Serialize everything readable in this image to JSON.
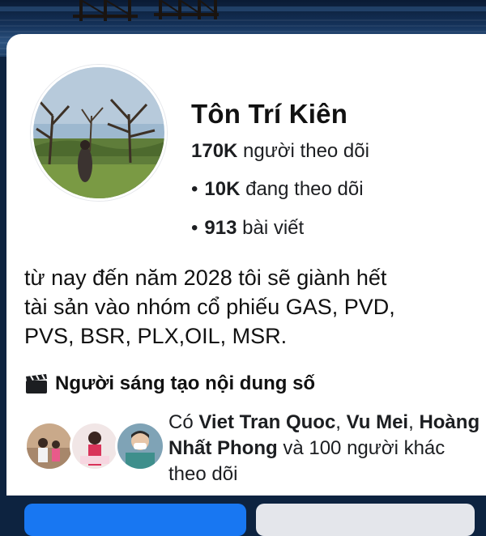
{
  "profile": {
    "name": "Tôn Trí Kiên",
    "followers_value": "170K",
    "followers_label": "người theo dõi",
    "following_value": "10K",
    "following_label": "đang theo dõi",
    "posts_value": "913",
    "posts_label": "bài viết",
    "bio_lines": [
      "từ nay đến năm 2028 tôi sẽ giành hết",
      "tài sản vào nhóm cổ phiếu GAS, PVD,",
      "PVS, BSR, PLX,OIL, MSR."
    ],
    "category": "Người sáng tạo nội dung số"
  },
  "followed_by": {
    "prefix": "Có",
    "name1": "Viet Tran Quoc",
    "sep1": ",",
    "name2": "Vu Mei",
    "sep2": ",",
    "name3": "Hoàng Nhất Phong",
    "middle": "và",
    "count": "100",
    "suffix": "người khác theo dõi"
  },
  "icons": {
    "category": "clapperboard-icon"
  },
  "colors": {
    "primary_button": "#1877f2",
    "secondary_button": "#e4e6eb"
  }
}
